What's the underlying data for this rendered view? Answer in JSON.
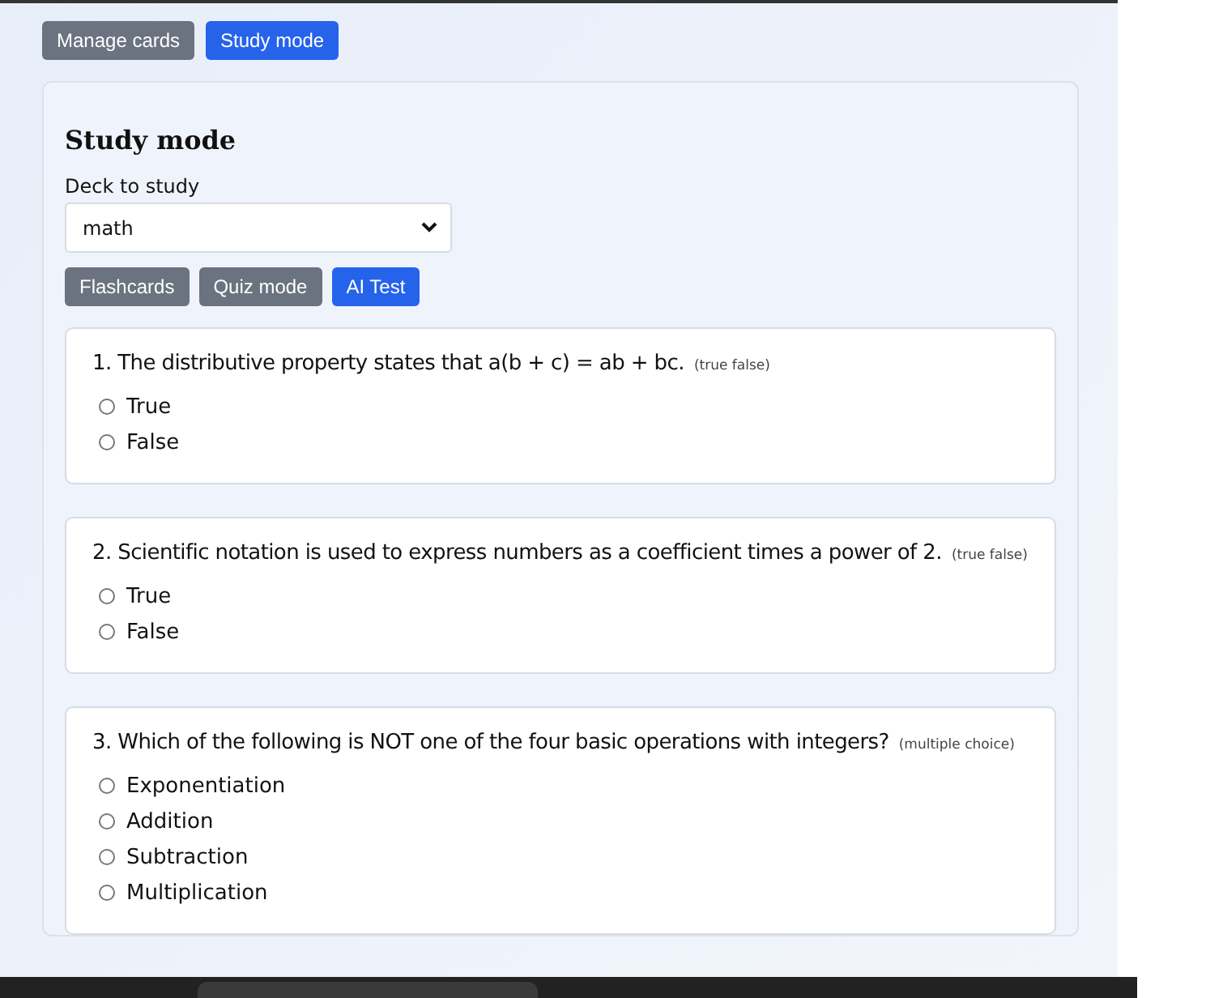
{
  "nav_tabs": [
    {
      "label": "Manage cards",
      "selected": false
    },
    {
      "label": "Study mode",
      "selected": true
    }
  ],
  "study": {
    "title": "Study mode",
    "deck_label": "Deck to study",
    "deck_value": "math",
    "modes": [
      {
        "label": "Flashcards",
        "selected": false
      },
      {
        "label": "Quiz mode",
        "selected": false
      },
      {
        "label": "AI Test",
        "selected": true
      }
    ],
    "questions": [
      {
        "text": "1. The distributive property states that a(b + c) = ab + bc.",
        "type": "(true false)",
        "options": [
          {
            "label": "True",
            "selected": false
          },
          {
            "label": "False",
            "selected": false
          }
        ]
      },
      {
        "text": "2. Scientific notation is used to express numbers as a coefficient times a power of 2.",
        "type": "(true false)",
        "options": [
          {
            "label": "True",
            "selected": false
          },
          {
            "label": "False",
            "selected": false
          }
        ]
      },
      {
        "text": "3. Which of the following is NOT one of the four basic operations with integers?",
        "type": "(multiple choice)",
        "options": [
          {
            "label": "Exponentiation",
            "selected": false
          },
          {
            "label": "Addition",
            "selected": false
          },
          {
            "label": "Subtraction",
            "selected": false
          },
          {
            "label": "Multiplication",
            "selected": false
          }
        ]
      }
    ]
  }
}
